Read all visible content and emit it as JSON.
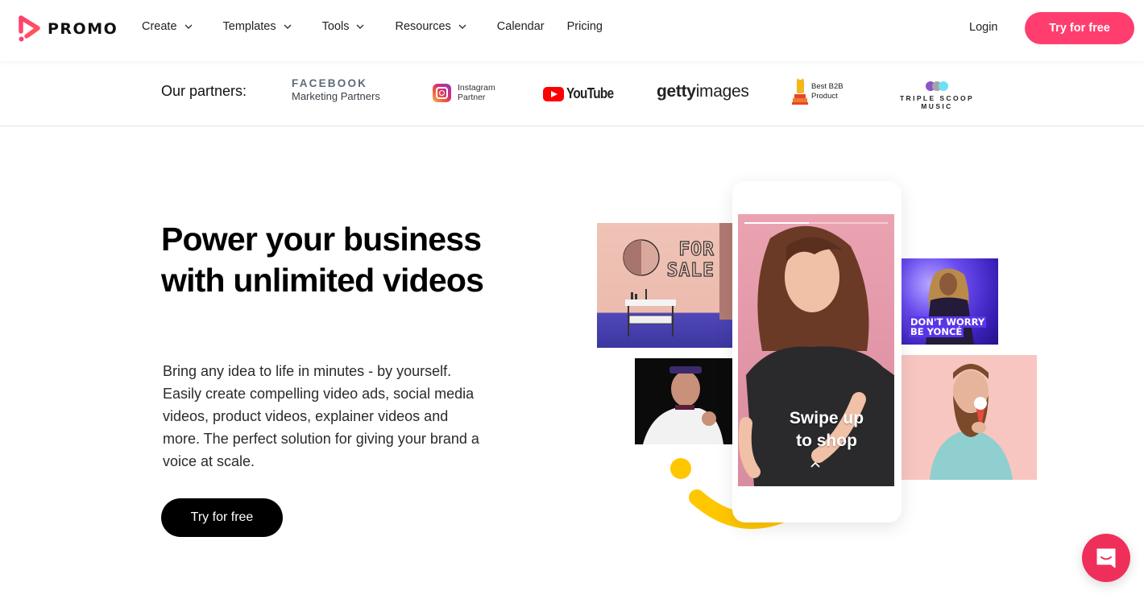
{
  "header": {
    "brand": "PROMO",
    "nav": [
      {
        "label": "Create",
        "has_dropdown": true
      },
      {
        "label": "Templates",
        "has_dropdown": true
      },
      {
        "label": "Tools",
        "has_dropdown": true
      },
      {
        "label": "Resources",
        "has_dropdown": true
      },
      {
        "label": "Calendar",
        "has_dropdown": false
      },
      {
        "label": "Pricing",
        "has_dropdown": false
      }
    ],
    "login_label": "Login",
    "cta_label": "Try for free"
  },
  "partners": {
    "label": "Our partners:",
    "facebook": {
      "line1": "FACEBOOK",
      "line2": "Marketing Partners"
    },
    "instagram": {
      "line1": "Instagram",
      "line2": "Partner"
    },
    "youtube": {
      "text": "YouTube"
    },
    "getty": {
      "bold": "getty",
      "light": "images"
    },
    "b2b": {
      "line1": "Best B2B",
      "line2": "Product"
    },
    "triple_scoop": {
      "text": "TRIPLE SCOOP MUSIC"
    }
  },
  "hero": {
    "title": "Power your business with unlimited videos",
    "description": "Bring any idea to life in minutes - by yourself. Easily create compelling video ads, social media videos, product videos, explainer videos and more. The perfect solution for giving your brand a voice at scale.",
    "cta_label": "Try for free"
  },
  "visuals": {
    "phone_overlay_line1": "Swipe up",
    "phone_overlay_line2": "to shop",
    "story_progress": 0.45,
    "sale_line1": "FOR",
    "sale_line2": "SALE",
    "beyonce_line1": "DON'T WORRY",
    "beyonce_line2": "BE YONCÉ"
  },
  "colors": {
    "brand_pink": "#ff3d6e",
    "chat_pink": "#ef2f5a",
    "accent_yellow": "#ffc700",
    "text_dark": "#111111"
  },
  "chat": {
    "icon": "chat-bubble-icon"
  }
}
